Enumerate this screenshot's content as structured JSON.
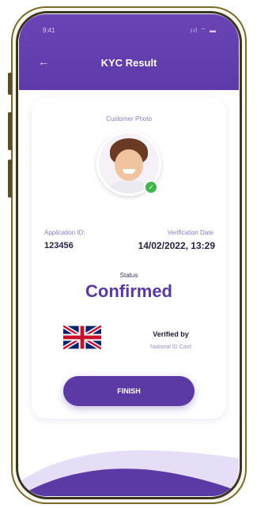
{
  "status_bar": {
    "time": "9:41",
    "icons": "ııl ⌔ ▬"
  },
  "header": {
    "back_icon": "←",
    "title": "KYC Result"
  },
  "customer": {
    "photo_caption": "Customer Photo",
    "verified_badge": "✓"
  },
  "details": {
    "application_id_label": "Application ID:",
    "application_id": "123456",
    "verification_date_label": "Verification Date",
    "verification_date": "14/02/2022, 13:29"
  },
  "status": {
    "label": "Status",
    "value": "Confirmed"
  },
  "verification": {
    "flag": "uk-flag",
    "verified_by": "Verified by",
    "document": "National ID Card"
  },
  "actions": {
    "finish_label": "FINISH"
  },
  "colors": {
    "primary": "#5b3aa5",
    "accent": "#8c7ac9",
    "success": "#3fb64b"
  }
}
